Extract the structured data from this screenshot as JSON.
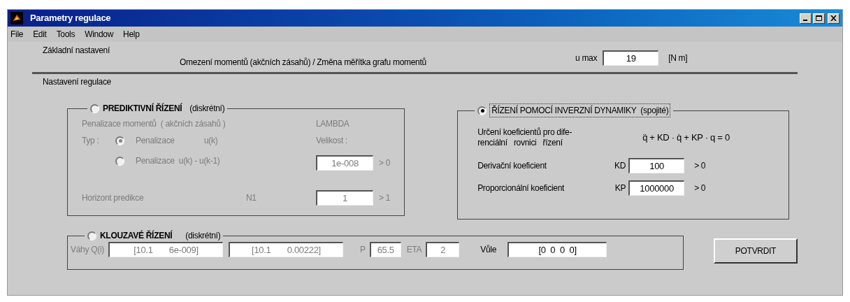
{
  "window": {
    "title": "Parametry regulace"
  },
  "menu": [
    {
      "label": "File"
    },
    {
      "label": "Edit"
    },
    {
      "label": "Tools"
    },
    {
      "label": "Window"
    },
    {
      "label": "Help"
    }
  ],
  "basic": {
    "title": "Základní nastavení",
    "description": "Omezení momentů (akčních zásahů) / Změna měřítka grafu momentů",
    "label": "u max",
    "value": "19",
    "unit": "[N m]"
  },
  "section_title": "Nastavení regulace",
  "predictive": {
    "title": "PREDIKTIVNÍ ŘÍZENÍ",
    "subtitle": "(diskrétní)",
    "selected": false,
    "disabled": true,
    "penalty_label": "Penalizace momentů  ( akčních zásahů )",
    "lambda_label": "LAMBDA",
    "type_label": "Typ :",
    "options": [
      {
        "label": "Penalizace",
        "term": "u(k)",
        "selected": true
      },
      {
        "label": "Penalizace  u(k) - u(k-1)",
        "selected": false
      }
    ],
    "size_label": "Velikost :",
    "size_value": "1e-008",
    "size_limit": "> 0",
    "horizon_label": "Horizont predikce",
    "horizon_symbol": "N1",
    "horizon_value": "1",
    "horizon_limit": "> 1"
  },
  "inverse": {
    "title": "ŘÍZENÍ POMOCÍ INVERZNÍ DYNAMIKY",
    "subtitle": "(spojité)",
    "selected": true,
    "focused": true,
    "description": [
      "Určení koeficientů pro dife-",
      "renciální   rovnici   řízení"
    ],
    "equation": "q̈ + KD · q̇ + KP · q = 0",
    "coefficients": [
      {
        "label": "Derivační koeficient",
        "symbol": "KD",
        "value": "100",
        "limit": "> 0"
      },
      {
        "label": "Proporcionální koeficient",
        "symbol": "KP",
        "value": "1000000",
        "limit": "> 0"
      }
    ]
  },
  "sliding": {
    "title": "KLOUZAVÉ ŘÍZENÍ",
    "subtitle": "(diskrétní)",
    "selected": false,
    "weights_label": "Váhy Q(i)",
    "weights_disabled": true,
    "weights": [
      "[10.1       6e-009]",
      "[10.1       0.00222]"
    ],
    "params": [
      {
        "label": "P",
        "value": "65.5",
        "disabled": true
      },
      {
        "label": "ETA",
        "value": "2",
        "disabled": true
      },
      {
        "label": "Vůle",
        "value": "[0  0  0  0]",
        "disabled": false
      }
    ]
  },
  "confirm_button": "POTVRDIT"
}
